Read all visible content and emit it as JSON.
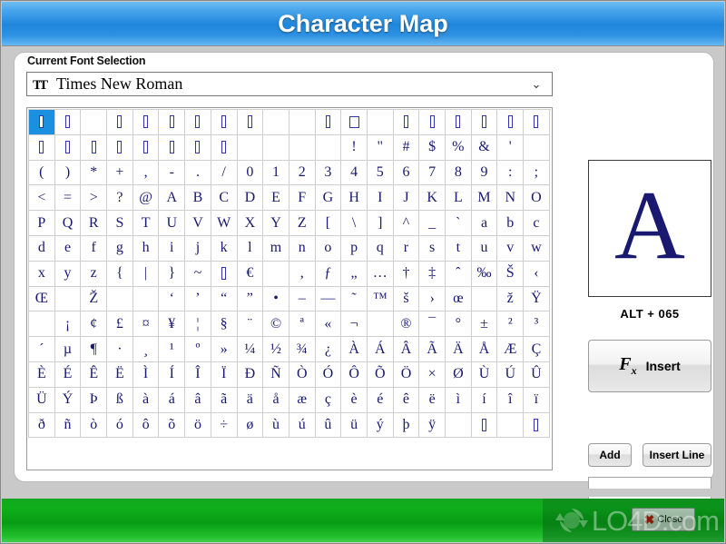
{
  "window": {
    "title": "Character Map",
    "titlebar_color": "#1f86dc"
  },
  "font_group": {
    "label": "Current Font Selection",
    "icon": "truetype-icon",
    "selected_font": "Times New Roman",
    "chevron": "chevron-down-icon"
  },
  "grid": {
    "columns": 20,
    "selected_index": 0,
    "rows": [
      [
        "▯",
        "▯",
        "",
        "▯",
        "▯",
        "▯",
        "▯",
        "▯",
        "▯",
        "",
        "",
        "▯",
        "□",
        "",
        "▯",
        "▯",
        "▯",
        "▯",
        "▯",
        "▯"
      ],
      [
        "▯",
        "▯",
        "▯",
        "▯",
        "▯",
        "▯",
        "▯",
        "▯",
        "",
        "",
        "",
        "",
        "!",
        "\"",
        "#",
        "$",
        "%",
        "&",
        "'",
        ""
      ],
      [
        "(",
        ")",
        "*",
        "+",
        ",",
        "-",
        ".",
        "/",
        "0",
        "1",
        "2",
        "3",
        "4",
        "5",
        "6",
        "7",
        "8",
        "9",
        ":",
        ";"
      ],
      [
        "<",
        "=",
        ">",
        "?",
        "@",
        "A",
        "B",
        "C",
        "D",
        "E",
        "F",
        "G",
        "H",
        "I",
        "J",
        "K",
        "L",
        "M",
        "N",
        "O"
      ],
      [
        "P",
        "Q",
        "R",
        "S",
        "T",
        "U",
        "V",
        "W",
        "X",
        "Y",
        "Z",
        "[",
        "\\",
        "]",
        "^",
        "_",
        "`",
        "a",
        "b",
        "c"
      ],
      [
        "d",
        "e",
        "f",
        "g",
        "h",
        "i",
        "j",
        "k",
        "l",
        "m",
        "n",
        "o",
        "p",
        "q",
        "r",
        "s",
        "t",
        "u",
        "v",
        "w"
      ],
      [
        "x",
        "y",
        "z",
        "{",
        "|",
        "}",
        "~",
        "▯",
        "€",
        "",
        "‚",
        "ƒ",
        "„",
        "…",
        "†",
        "‡",
        "ˆ",
        "‰",
        "Š",
        "‹"
      ],
      [
        "Œ",
        "",
        "Ž",
        "",
        "",
        "‘",
        "’",
        "“",
        "”",
        "•",
        "–",
        "—",
        "˜",
        "™",
        "š",
        "›",
        "œ",
        "",
        "ž",
        "Ÿ"
      ],
      [
        "",
        "¡",
        "¢",
        "£",
        "¤",
        "¥",
        "¦",
        "§",
        "¨",
        "©",
        "ª",
        "«",
        "¬",
        "­",
        "®",
        "¯",
        "°",
        "±",
        "²",
        "³"
      ],
      [
        "´",
        "µ",
        "¶",
        "·",
        "¸",
        "¹",
        "º",
        "»",
        "¼",
        "½",
        "¾",
        "¿",
        "À",
        "Á",
        "Â",
        "Ã",
        "Ä",
        "Å",
        "Æ",
        "Ç"
      ],
      [
        "È",
        "É",
        "Ê",
        "Ë",
        "Ì",
        "Í",
        "Î",
        "Ï",
        "Ð",
        "Ñ",
        "Ò",
        "Ó",
        "Ô",
        "Õ",
        "Ö",
        "×",
        "Ø",
        "Ù",
        "Ú",
        "Û"
      ],
      [
        "Ü",
        "Ý",
        "Þ",
        "ß",
        "à",
        "á",
        "â",
        "ã",
        "ä",
        "å",
        "æ",
        "ç",
        "è",
        "é",
        "ê",
        "ë",
        "ì",
        "í",
        "î",
        "ï"
      ],
      [
        "ð",
        "ñ",
        "ò",
        "ó",
        "ô",
        "õ",
        "ö",
        "÷",
        "ø",
        "ù",
        "ú",
        "û",
        "ü",
        "ý",
        "þ",
        "ÿ",
        "",
        "▯",
        "",
        "▯"
      ]
    ]
  },
  "preview": {
    "character": "A",
    "alt_code": "ALT +  065"
  },
  "actions": {
    "insert_label": "Insert",
    "insert_icon": "fx-icon",
    "add_label": "Add",
    "insert_line_label": "Insert Line",
    "text_field_value": "",
    "text_field_placeholder": ""
  },
  "footer": {
    "close_label": "Close",
    "close_icon": "red-x-icon",
    "watermark_text": "LO4D.com",
    "watermark_logo": "recycle-logo-icon",
    "bar_color": "#0faf1c"
  }
}
